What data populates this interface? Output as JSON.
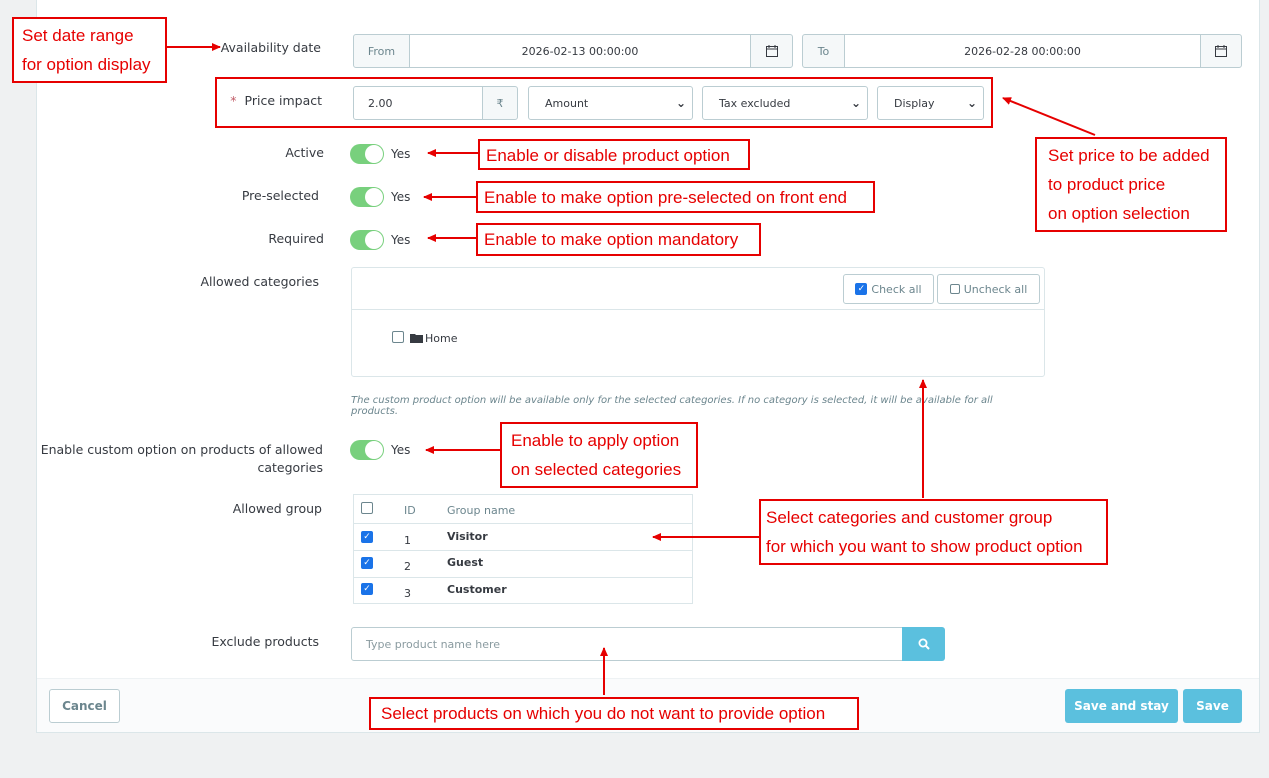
{
  "labels": {
    "availability_date": "Availability date",
    "price_impact": "Price impact",
    "required_star": "*",
    "active": "Active",
    "preselected": "Pre-selected",
    "required": "Required",
    "allowed_categories": "Allowed categories",
    "enable_custom_line1": "Enable custom option on products of allowed",
    "enable_custom_line2": "categories",
    "allowed_group": "Allowed group",
    "exclude_products": "Exclude products"
  },
  "date": {
    "from_label": "From",
    "from_value": "2026-02-13 00:00:00",
    "to_label": "To",
    "to_value": "2026-02-28 00:00:00"
  },
  "price": {
    "value": "2.00",
    "currency_symbol": "₹",
    "type": "Amount",
    "tax": "Tax excluded",
    "display": "Display"
  },
  "toggles": {
    "yes": "Yes"
  },
  "categories": {
    "check_all": "Check all",
    "uncheck_all": "Uncheck all",
    "home": "Home",
    "help": "The custom product option will be available only for the selected categories. If no category is selected, it will be available for all products."
  },
  "groups": {
    "col_id": "ID",
    "col_name": "Group name",
    "rows": [
      {
        "id": "1",
        "name": "Visitor",
        "checked": true
      },
      {
        "id": "2",
        "name": "Guest",
        "checked": true
      },
      {
        "id": "3",
        "name": "Customer",
        "checked": true
      }
    ]
  },
  "exclude": {
    "placeholder": "Type product name here"
  },
  "footer": {
    "cancel": "Cancel",
    "save_and_stay": "Save and stay",
    "save": "Save"
  },
  "annotations": {
    "date_range_l1": "Set date range",
    "date_range_l2": "for option display",
    "price_l1": "Set price to be added",
    "price_l2": "to product price",
    "price_l3": "on option selection",
    "active": "Enable or disable product option",
    "preselected": "Enable to make option pre-selected on front end",
    "required": "Enable to make option mandatory",
    "apply_l1": "Enable to apply option",
    "apply_l2": "on selected categories",
    "select_l1": "Select categories and customer group",
    "select_l2": "for which you want to show product option",
    "exclude": "Select products on which you do not want to provide option"
  },
  "colors": {
    "annotation_red": "#e60000",
    "toggle_green": "#78d07d",
    "save_blue": "#5bc0de",
    "search_blue": "#5bc0de"
  }
}
